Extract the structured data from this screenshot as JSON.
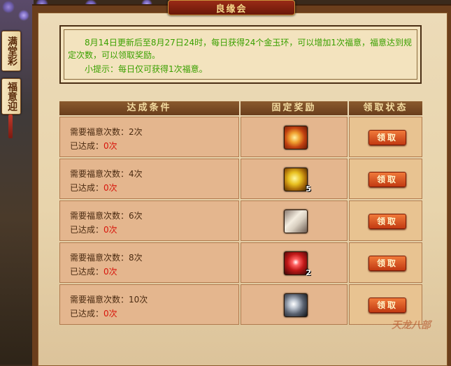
{
  "window": {
    "title": "良缘会"
  },
  "side_tabs": [
    "满堂彩",
    "福意迎"
  ],
  "notice": {
    "line1": "8月14日更新后至8月27日24时，每日获得24个金玉环，可以增加1次福意，福意达到规定次数，可以领取奖励。",
    "line2": "小提示：每日仅可获得1次福意。"
  },
  "table": {
    "headers": [
      "达成条件",
      "固定奖励",
      "领取状态"
    ],
    "rows": [
      {
        "requirement": "需要福意次数：2次",
        "achieved_label": "已达成：",
        "achieved_value": "0次",
        "reward_icon": "orange-orb-icon",
        "reward_count": "",
        "button": "领取"
      },
      {
        "requirement": "需要福意次数：4次",
        "achieved_label": "已达成：",
        "achieved_value": "0次",
        "reward_icon": "gold-ingot-icon",
        "reward_count": "5",
        "button": "领取"
      },
      {
        "requirement": "需要福意次数：6次",
        "achieved_label": "已达成：",
        "achieved_value": "0次",
        "reward_icon": "scroll-icon",
        "reward_count": "",
        "button": "领取"
      },
      {
        "requirement": "需要福意次数：8次",
        "achieved_label": "已达成：",
        "achieved_value": "0次",
        "reward_icon": "red-firework-icon",
        "reward_count": "2",
        "button": "领取"
      },
      {
        "requirement": "需要福意次数：10次",
        "achieved_label": "已达成：",
        "achieved_value": "0次",
        "reward_icon": "silver-gem-icon",
        "reward_count": "",
        "button": "领取"
      }
    ]
  },
  "watermark": "天龙八部"
}
